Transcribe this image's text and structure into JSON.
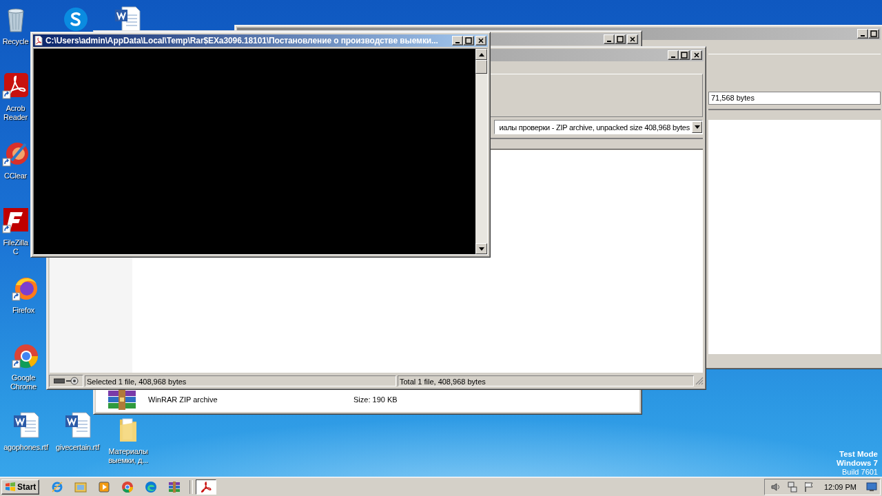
{
  "desktop_icons": [
    {
      "kind": "recycle-bin",
      "label": "Recycle"
    },
    {
      "kind": "skype"
    },
    {
      "kind": "word-document"
    },
    {
      "kind": "acrobat",
      "label": "Acrob Reader"
    },
    {
      "kind": "ccleaner",
      "label": "CClear"
    },
    {
      "kind": "filezilla",
      "label": "FileZilla C"
    },
    {
      "kind": "firefox",
      "label": "Firefox"
    },
    {
      "kind": "chrome",
      "label": "Google Chrome"
    },
    {
      "kind": "word-document",
      "label": "agophones.rtf"
    },
    {
      "kind": "word-document",
      "label": "givecertain.rtf"
    },
    {
      "kind": "folder",
      "label": "Материалы выемки, д..."
    }
  ],
  "back_window": {
    "active": false,
    "size_field": "71,568 bytes"
  },
  "explorer_window": {
    "active": false,
    "file_type": "WinRAR ZIP archive",
    "file_size": "Size: 190 KB"
  },
  "winrar_window": {
    "active": false,
    "address": "иалы проверки - ZIP archive, unpacked size 408,968 bytes",
    "status_selected": "Selected 1 file, 408,968 bytes",
    "status_total": "Total 1 file, 408,968 bytes"
  },
  "pdf_window": {
    "active": true,
    "title": "C:\\Users\\admin\\AppData\\Local\\Temp\\Rar$EXa3096.18101\\Постановление о производстве выемки..."
  },
  "taskbar": {
    "start_label": "Start",
    "apps": [
      {
        "kind": "internet-explorer",
        "selected": false
      },
      {
        "kind": "explorer",
        "selected": false
      },
      {
        "kind": "media-player",
        "selected": false
      },
      {
        "kind": "chrome",
        "selected": false
      },
      {
        "kind": "edge",
        "selected": false
      },
      {
        "kind": "winrar",
        "selected": false
      },
      {
        "kind": "acrobat",
        "selected": true
      }
    ],
    "clock": "12:09 PM"
  },
  "system_notice": [
    "Test Mode",
    "Windows 7",
    "Build 7601"
  ]
}
